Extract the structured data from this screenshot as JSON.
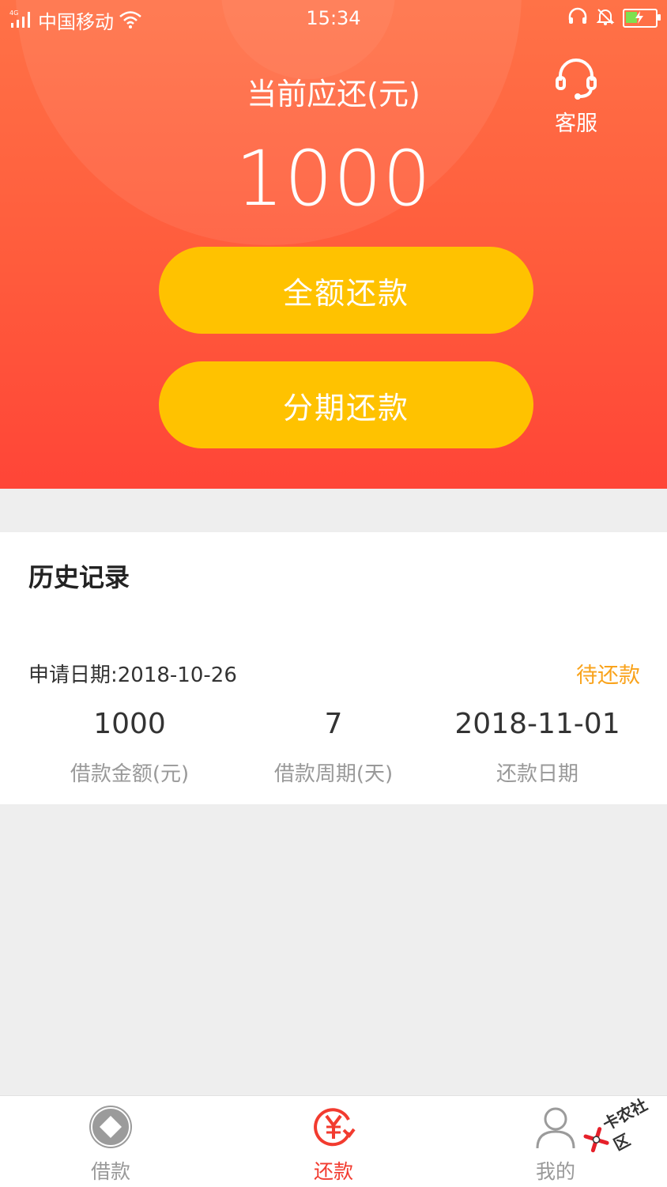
{
  "status_bar": {
    "network": "4G",
    "carrier": "中国移动",
    "time": "15:34"
  },
  "hero": {
    "label": "当前应还(元)",
    "amount": "1000",
    "customer_service_label": "客服"
  },
  "actions": {
    "full_repay_label": "全额还款",
    "installment_label": "分期还款"
  },
  "history": {
    "title": "历史记录",
    "record": {
      "apply_date": "申请日期:2018-10-26",
      "status": "待还款",
      "loan_amount": "1000",
      "loan_amount_label": "借款金额(元)",
      "period": "7",
      "period_label": "借款周期(天)",
      "repay_date": "2018-11-01",
      "repay_date_label": "还款日期"
    }
  },
  "tabs": [
    {
      "label": "借款",
      "icon": "diamond-coin-icon"
    },
    {
      "label": "还款",
      "icon": "yuan-return-icon"
    },
    {
      "label": "我的",
      "icon": "user-icon"
    }
  ],
  "watermark": {
    "text": "卡农社区"
  },
  "colors": {
    "hero_top": "#ff7247",
    "hero_bottom": "#ff4537",
    "button": "#ffc200",
    "status_pending": "#f9a31c",
    "tab_active": "#f23b2f",
    "tab_inactive": "#999999"
  }
}
